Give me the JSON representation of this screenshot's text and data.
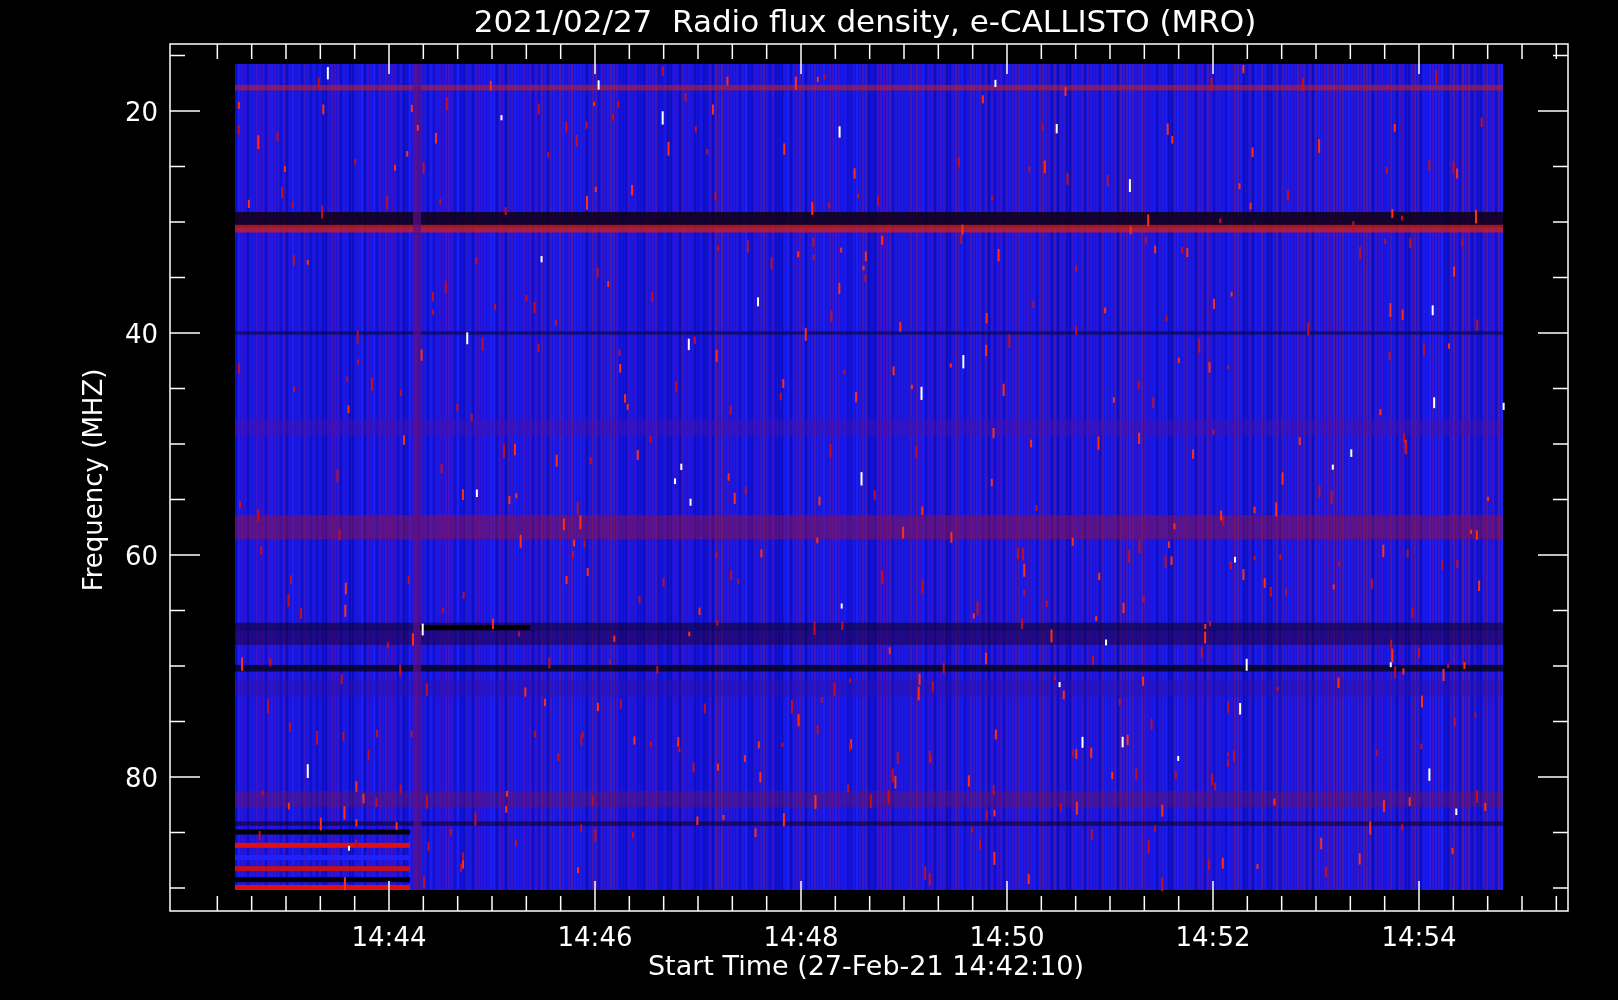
{
  "title": "2021/02/27  Radio flux density, e-CALLISTO (MRO)",
  "y_axis": {
    "label": "Frequency (MHZ)",
    "ticks": [
      "20",
      "40",
      "60",
      "80"
    ]
  },
  "x_axis": {
    "label": "Start Time (27-Feb-21 14:42:10)",
    "ticks": [
      "14:44",
      "14:46",
      "14:48",
      "14:50",
      "14:52",
      "14:54"
    ]
  }
}
